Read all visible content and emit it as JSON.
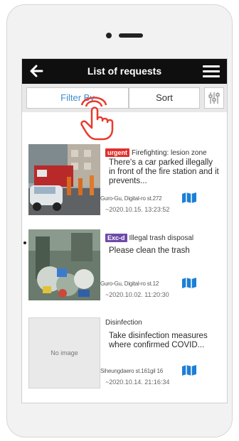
{
  "header": {
    "title": "List of requests"
  },
  "tabs": {
    "filter_label": "Filter By",
    "sort_label": "Sort"
  },
  "requests": [
    {
      "badge": "urgent",
      "badge_color": "#e0302c",
      "category": "Firefighting: lesion zone",
      "description": "There's a car parked illegally in front of the fire station and it prevents...",
      "address": "Guro-Gu, Digital-ro st.272",
      "date": "~2020.10.15. 13:23:52",
      "image": "photo-fire-station"
    },
    {
      "badge": "Exc-d",
      "badge_color": "#6e4aa8",
      "category": "Illegal trash disposal",
      "description": "Please clean the trash",
      "address": "Guro-Gu, Digital-ro st.12",
      "date": "~2020.10.02. 11:20:30",
      "image": "photo-trash"
    },
    {
      "badge": "",
      "badge_color": "",
      "category": "Disinfection",
      "description": "Take disinfection measures where confirmed COVID...",
      "address": "Siheungdaero st.161gil 16",
      "date": "~2020.10.14. 21:16:34",
      "image_placeholder": "No image"
    }
  ],
  "colors": {
    "accent": "#3d8fd0",
    "header_bg": "#0f0f0f",
    "hand": "#e83b2e"
  }
}
